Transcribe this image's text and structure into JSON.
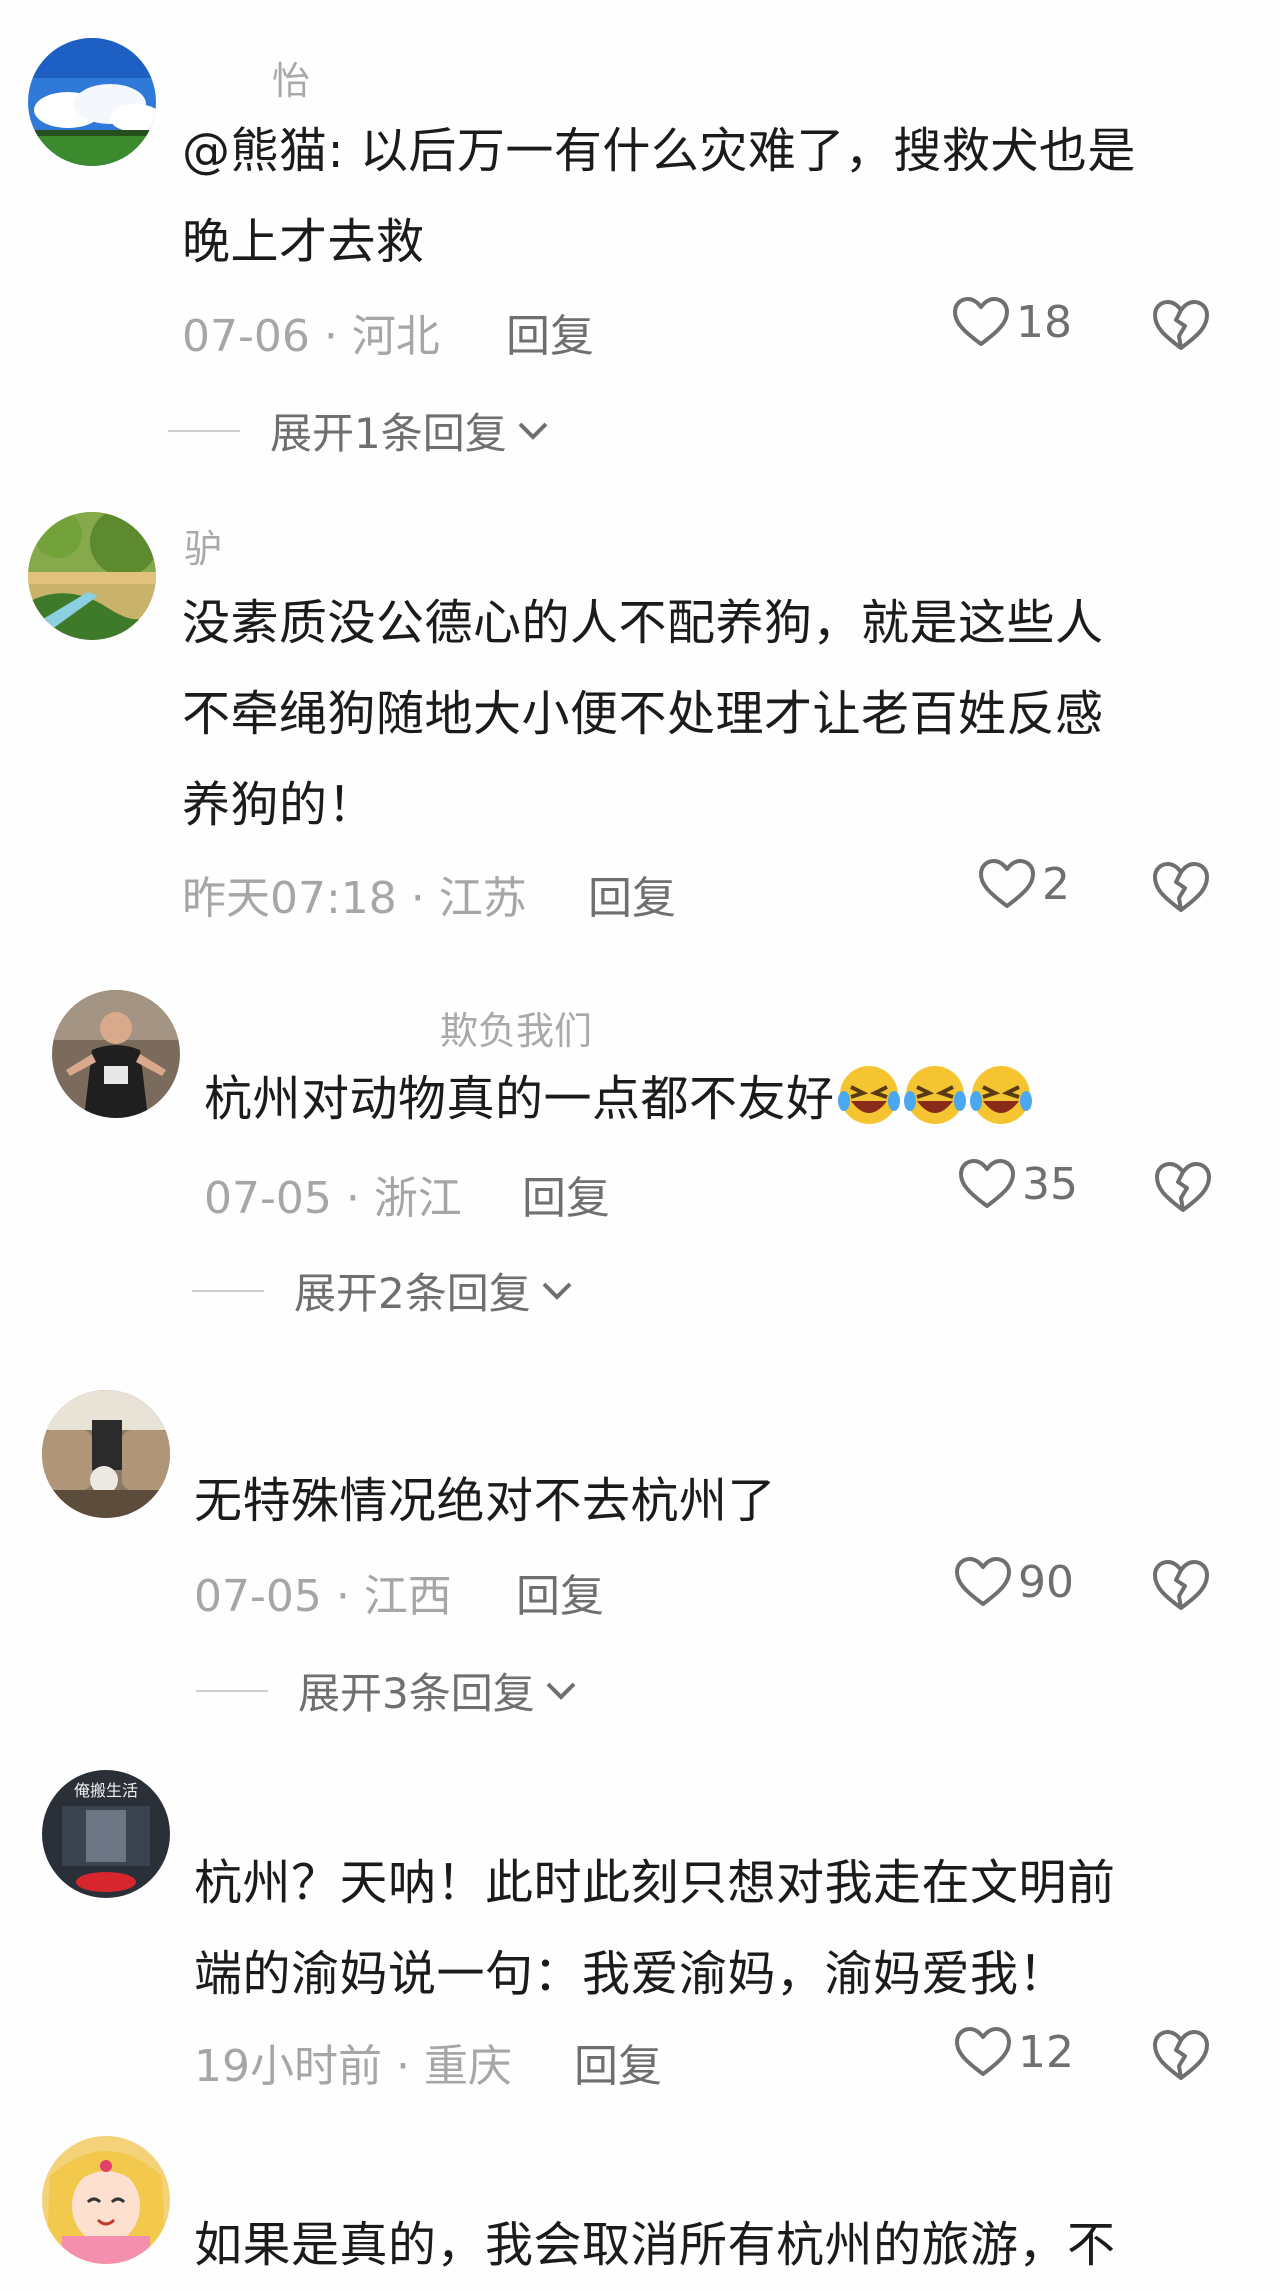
{
  "comments": [
    {
      "username": "怡",
      "text_lines": [
        "@熊猫: 以后万一有什么灾难了，搜救犬也是",
        "晚上才去救"
      ],
      "meta": "07-06 · 河北",
      "reply_label": "回复",
      "likes": "18",
      "expand_label": "展开1条回复",
      "avatar_icon": "sky-landscape-avatar"
    },
    {
      "username": "驴",
      "text_lines": [
        "没素质没公德心的人不配养狗，就是这些人",
        "不牵绳狗随地大小便不处理才让老百姓反感",
        "养狗的！"
      ],
      "meta": "昨天07:18 · 江苏",
      "reply_label": "回复",
      "likes": "2",
      "avatar_icon": "nature-scene-avatar"
    },
    {
      "username": "欺负我们",
      "text_lines": [
        "杭州对动物真的一点都不友好"
      ],
      "emoji_count": 3,
      "meta": "07-05 · 浙江",
      "reply_label": "回复",
      "likes": "35",
      "expand_label": "展开2条回复",
      "avatar_icon": "person-photo-avatar"
    },
    {
      "username": "",
      "text_lines": [
        "无特殊情况绝对不去杭州了"
      ],
      "meta": "07-05 · 江西",
      "reply_label": "回复",
      "likes": "90",
      "expand_label": "展开3条回复",
      "avatar_icon": "car-interior-avatar"
    },
    {
      "username": "",
      "avatar_text": "俺搬生活",
      "text_lines": [
        "杭州？天呐！此时此刻只想对我走在文明前",
        "端的渝妈说一句：我爱渝妈，渝妈爱我！"
      ],
      "meta": "19小时前 · 重庆",
      "reply_label": "回复",
      "likes": "12",
      "avatar_icon": "dark-logo-avatar"
    },
    {
      "username": "",
      "text_lines": [
        "如果是真的，我会取消所有杭州的旅游，不"
      ],
      "avatar_icon": "cartoon-girl-avatar"
    }
  ],
  "colors": {
    "text": "#1b1b1b",
    "meta": "#a6a6a6",
    "action": "#6f6f6f",
    "background": "#fefefe"
  }
}
